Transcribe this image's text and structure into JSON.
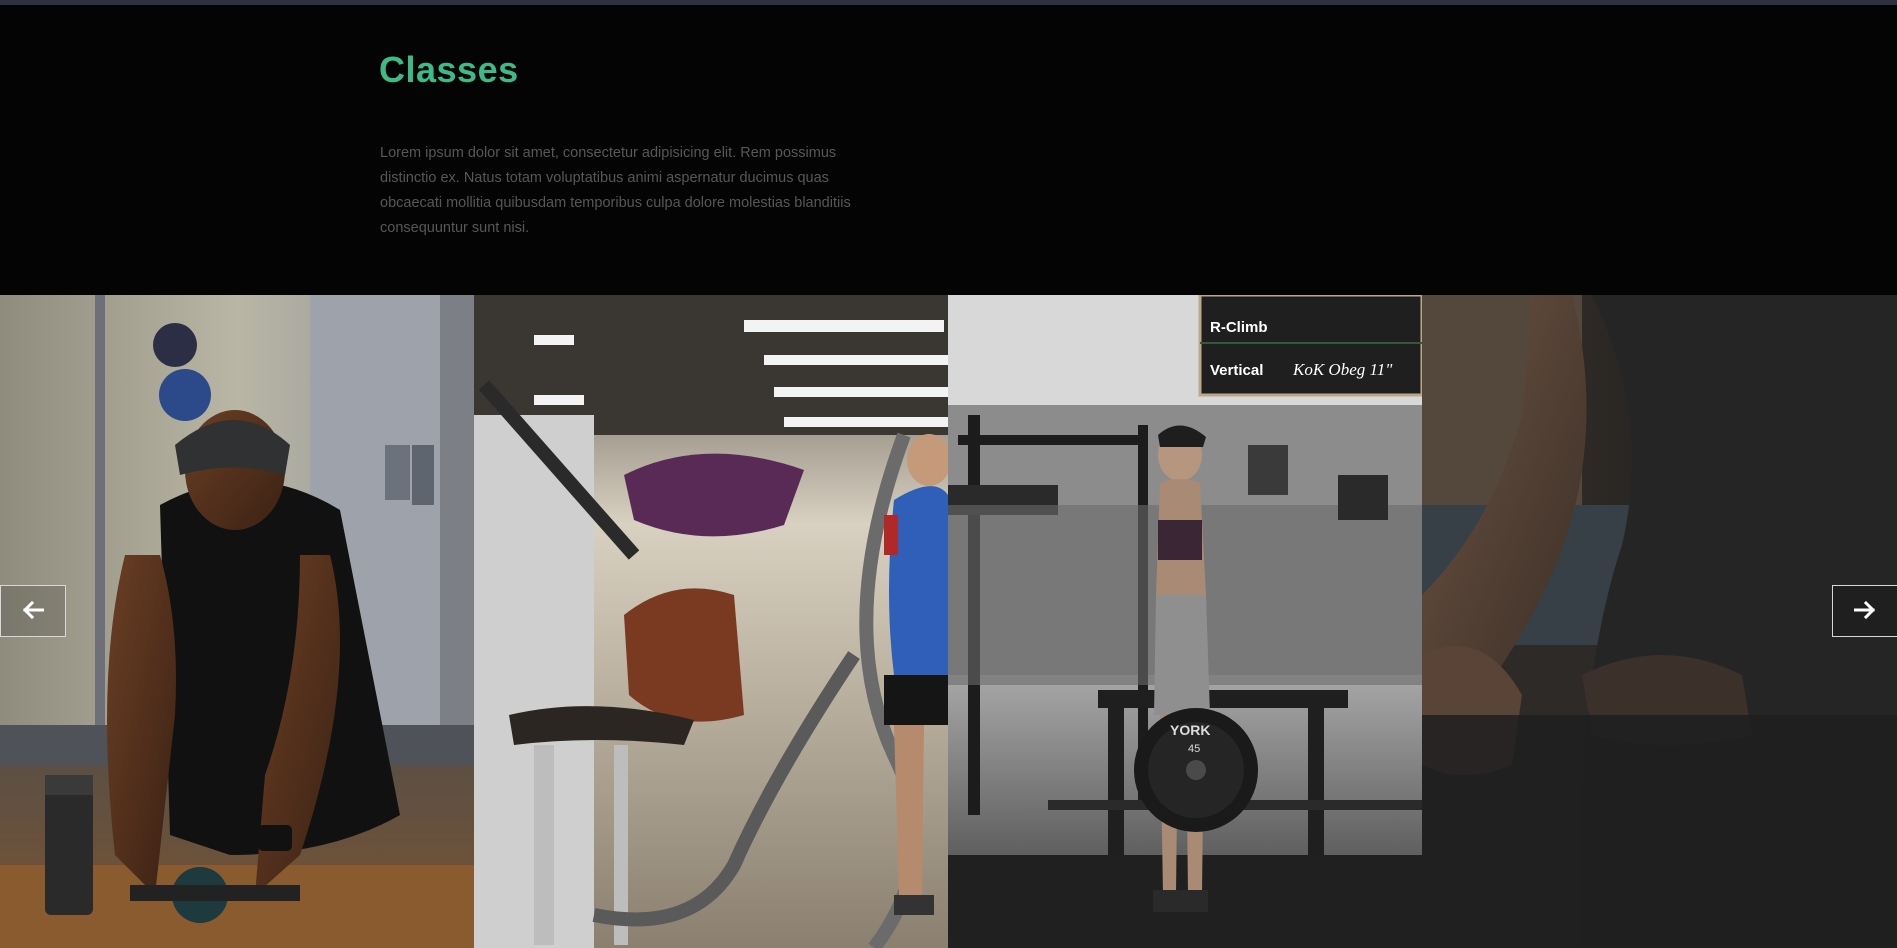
{
  "section": {
    "title": "Classes",
    "description": "Lorem ipsum dolor sit amet, consectetur adipisicing elit. Rem possimus distinctio ex. Natus totam voluptatibus animi aspernatur ducimus quas obcaecati mollitia quibusdam temporibus culpa dolore molestias blanditiis consequuntur sunt nisi."
  },
  "gallery": {
    "images": [
      {
        "name": "man-ab-roller",
        "signage": []
      },
      {
        "name": "man-battle-ropes",
        "signage": []
      },
      {
        "name": "woman-holding-plate",
        "signage": [
          "R-Climb",
          "Vertical",
          "KoK Obeg 11\"",
          "YORK",
          "45"
        ]
      },
      {
        "name": "person-dark-closeup",
        "signage": []
      }
    ]
  },
  "controls": {
    "prev_icon": "arrow-left-icon",
    "next_icon": "arrow-right-icon",
    "prev_glyph": "🡐",
    "next_glyph": "🡒"
  },
  "colors": {
    "accent": "#3dbb86",
    "background": "#040404",
    "text_muted": "#575757",
    "top_bar": "#2f3142"
  }
}
